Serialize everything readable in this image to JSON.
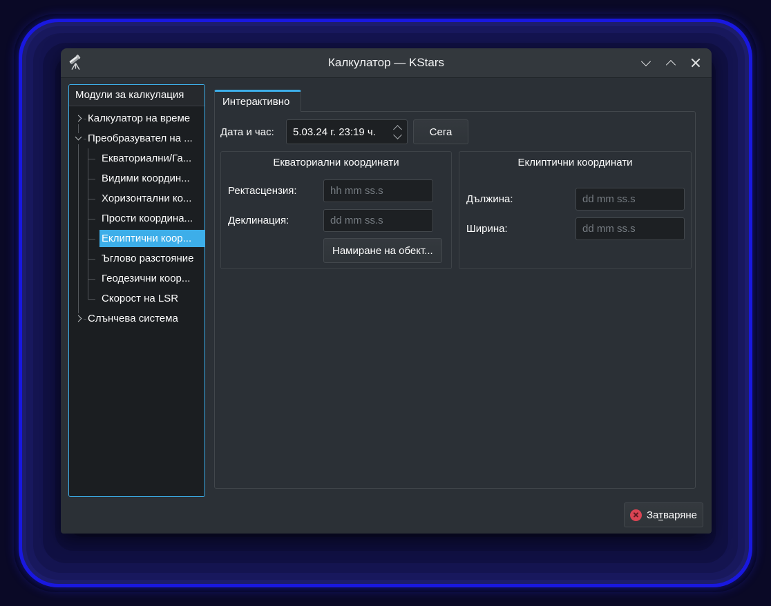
{
  "window": {
    "title": "Калкулатор — KStars",
    "app_icon": "telescope"
  },
  "sidebar": {
    "header": "Модули за калкулация",
    "tree": [
      {
        "label": "Калкулатор на време",
        "level": 0,
        "expander": "collapsed"
      },
      {
        "label": "Преобразувател на ...",
        "level": 0,
        "expander": "expanded"
      },
      {
        "label": "Екваториални/Га...",
        "level": 1
      },
      {
        "label": "Видими координ...",
        "level": 1
      },
      {
        "label": "Хоризонтални ко...",
        "level": 1
      },
      {
        "label": "Прости координа...",
        "level": 1
      },
      {
        "label": "Еклиптични коор...",
        "level": 1,
        "selected": true
      },
      {
        "label": "Ъглово разстояние",
        "level": 1
      },
      {
        "label": "Геодезични коор...",
        "level": 1
      },
      {
        "label": "Скорост на LSR",
        "level": 1,
        "last": true
      },
      {
        "label": "Слънчева система",
        "level": 0,
        "expander": "collapsed"
      }
    ]
  },
  "main": {
    "tab_label": "Интерактивно",
    "datetime": {
      "label": "Дата и час:",
      "value": "5.03.24 г. 23:19 ч.",
      "now_button": "Сега"
    },
    "equatorial": {
      "title": "Екваториални координати",
      "ra_label": "Ректасцензия:",
      "ra_placeholder": "hh mm ss.s",
      "dec_label": "Деклинация:",
      "dec_placeholder": "dd mm ss.s",
      "find_button": "Намиране на обект..."
    },
    "ecliptic": {
      "title": "Еклиптични координати",
      "lon_label": "Дължина:",
      "lon_placeholder": "dd mm ss.s",
      "lat_label": "Ширина:",
      "lat_placeholder": "dd mm ss.s"
    }
  },
  "footer": {
    "close_pre": "За",
    "close_accel": "т",
    "close_post": "варяне"
  },
  "colors": {
    "highlight": "#3daee9",
    "close_icon_red": "#da4453",
    "window_bg": "#2b3036",
    "view_bg": "#1d2023"
  }
}
